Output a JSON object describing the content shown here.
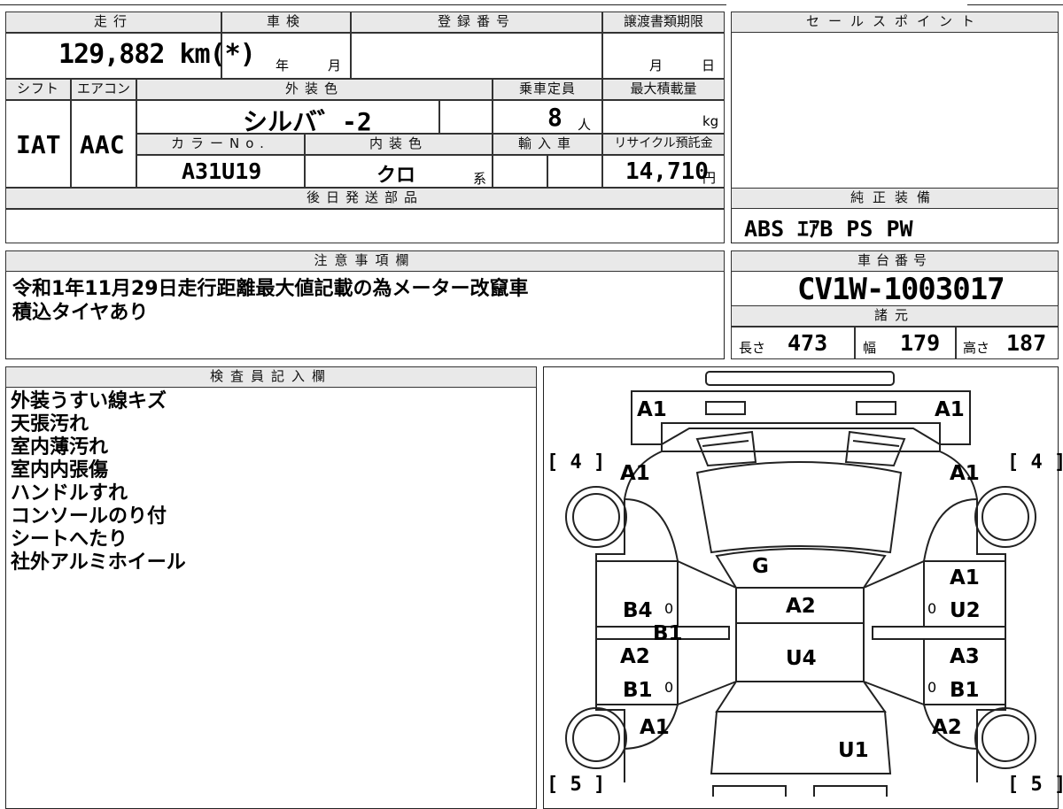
{
  "top_section": {
    "headers": {
      "mileage": "走行",
      "inspection": "車検",
      "registration": "登録番号",
      "transfer_deadline": "譲渡書類期限",
      "shift": "シフト",
      "aircon": "エアコン",
      "exterior_color": "外装色",
      "capacity": "乗車定員",
      "max_load": "最大積載量",
      "color_no": "カラーNo.",
      "interior_color": "内装色",
      "import": "輸入車",
      "recycle": "リサイクル預託金",
      "later_parts": "後日発送部品"
    },
    "mileage": "129,882 km(*)",
    "inspection_year_unit": "年",
    "inspection_month_unit": "月",
    "transfer_month_unit": "月",
    "transfer_day_unit": "日",
    "shift": "IAT",
    "aircon": "AAC",
    "exterior_color": "シルバ゛-2",
    "capacity": "8",
    "capacity_unit": "人",
    "max_load_unit": "kg",
    "color_no": "A31U19",
    "interior_color": "クロ",
    "interior_suffix": "系",
    "recycle": "14,710",
    "recycle_unit": "円"
  },
  "sales_point": {
    "header": "セールスポイント"
  },
  "equipment": {
    "header": "純正装備",
    "value": "ABS ｴｱB PS PW"
  },
  "notes": {
    "header": "注意事項欄",
    "lines": [
      "令和1年11月29日走行距離最大値記載の為メーター改竄車",
      "積込タイヤあり"
    ]
  },
  "chassis": {
    "header": "車台番号",
    "value": "CV1W-1003017"
  },
  "specs": {
    "header": "諸元",
    "length_label": "長さ",
    "length": "473",
    "width_label": "幅",
    "width": "179",
    "height_label": "高さ",
    "height": "187"
  },
  "inspector": {
    "header": "検査員記入欄",
    "lines": [
      "外装うすい線キズ",
      "天張汚れ",
      "室内薄汚れ",
      "室内内張傷",
      "ハンドルすれ",
      "コンソールのり付",
      "シートへたり",
      "社外アルミホイール"
    ]
  },
  "diagram": {
    "tire_front_left": "[ 4 ]",
    "tire_front_right": "[ 4 ]",
    "tire_rear_left": "[ 5 ]",
    "tire_rear_right": "[ 5 ]",
    "marks": [
      {
        "id": "front-left-corner",
        "text": "A1"
      },
      {
        "id": "front-right-corner",
        "text": "A1"
      },
      {
        "id": "front-left-fender",
        "text": "A1"
      },
      {
        "id": "front-right-fender",
        "text": "A1"
      },
      {
        "id": "windshield",
        "text": "G"
      },
      {
        "id": "roof",
        "text": "A2"
      },
      {
        "id": "roof-rear",
        "text": "U4"
      },
      {
        "id": "left-front-door-1",
        "text": "B4"
      },
      {
        "id": "left-front-door-2",
        "text": "B1"
      },
      {
        "id": "left-rear-door-1",
        "text": "A2"
      },
      {
        "id": "left-rear-door-2",
        "text": "B1"
      },
      {
        "id": "right-front-door-1",
        "text": "A1"
      },
      {
        "id": "right-front-door-2",
        "text": "U2"
      },
      {
        "id": "right-rear-door-1",
        "text": "A3"
      },
      {
        "id": "right-rear-door-2",
        "text": "B1"
      },
      {
        "id": "rear-left-fender",
        "text": "A1"
      },
      {
        "id": "rear-right-fender",
        "text": "A2"
      },
      {
        "id": "rear-gate",
        "text": "U1"
      }
    ],
    "handle_glyph": "0"
  }
}
